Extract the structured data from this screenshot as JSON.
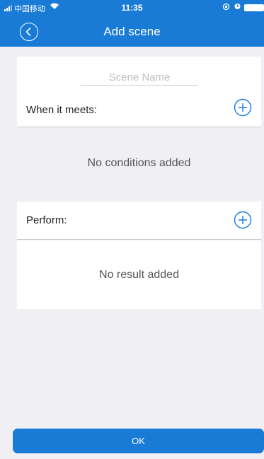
{
  "status_bar": {
    "carrier": "中国移动",
    "time": "11:35"
  },
  "header": {
    "title": "Add scene"
  },
  "scene_name": {
    "placeholder": "Scene Name",
    "value": ""
  },
  "conditions": {
    "label": "When it meets:",
    "empty_text": "No conditions added"
  },
  "actions": {
    "label": "Perform:",
    "empty_text": "No result added"
  },
  "ok_button": {
    "label": "OK"
  },
  "colors": {
    "accent": "#1a7bd7",
    "background": "#efeff4",
    "card": "#ffffff"
  }
}
